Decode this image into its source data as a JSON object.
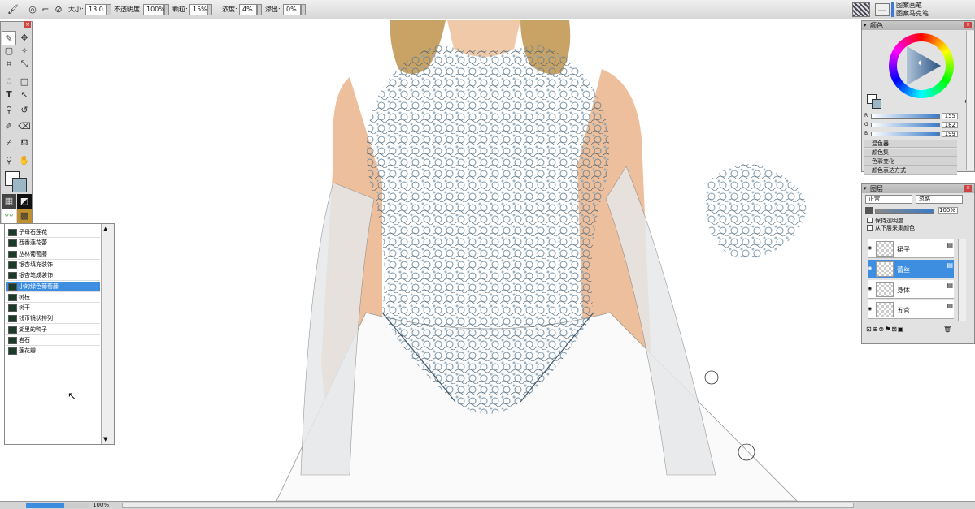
{
  "toolbar": {
    "size_label": "大小:",
    "size_value": "13.0",
    "opacity_label": "不透明度:",
    "opacity_value": "100%",
    "grain_label": "颗粒:",
    "grain_value": "15%",
    "density_label": "浓度:",
    "density_value": "4%",
    "bleed_label": "渗出:",
    "bleed_value": "0%",
    "brush_category": "图案画笔",
    "brush_variant": "图案马克笔"
  },
  "color_panel": {
    "title": "颜色",
    "r_label": "R",
    "r_value": "155",
    "g_label": "G",
    "g_value": "182",
    "b_label": "B",
    "b_value": "199",
    "current_color": "#9bb6c7",
    "sections": [
      "混色器",
      "颜色集",
      "色彩变化",
      "颜色表达方式"
    ]
  },
  "layers_panel": {
    "title": "图层",
    "blend_mode": "正常",
    "composite": "忽略",
    "opacity": "100%",
    "preserve_transparency": "保持透明度",
    "pick_from_below": "从下层采集颜色",
    "layers": [
      {
        "name": "裙子",
        "selected": false
      },
      {
        "name": "蕾丝",
        "selected": true
      },
      {
        "name": "身体",
        "selected": false
      },
      {
        "name": "五官",
        "selected": false
      }
    ]
  },
  "brush_list": {
    "items": [
      {
        "label": "子母石莲花",
        "selected": false
      },
      {
        "label": "西番莲花蕾",
        "selected": false
      },
      {
        "label": "丛林葡萄藤",
        "selected": false
      },
      {
        "label": "银杏填充装饰",
        "selected": false
      },
      {
        "label": "银杏笔成装饰",
        "selected": false
      },
      {
        "label": "小的绿色葡萄藤",
        "selected": true
      },
      {
        "label": "树枝",
        "selected": false
      },
      {
        "label": "树干",
        "selected": false
      },
      {
        "label": "钱币镜状排列",
        "selected": false
      },
      {
        "label": "湖里的鸭子",
        "selected": false
      },
      {
        "label": "岩石",
        "selected": false
      },
      {
        "label": "莲花瓣",
        "selected": false
      }
    ]
  },
  "status": {
    "zoom": "100%"
  },
  "canvas": {
    "skin": "#f2cdb0",
    "hair": "#c9a86a",
    "lace": "#6e8ea5"
  }
}
